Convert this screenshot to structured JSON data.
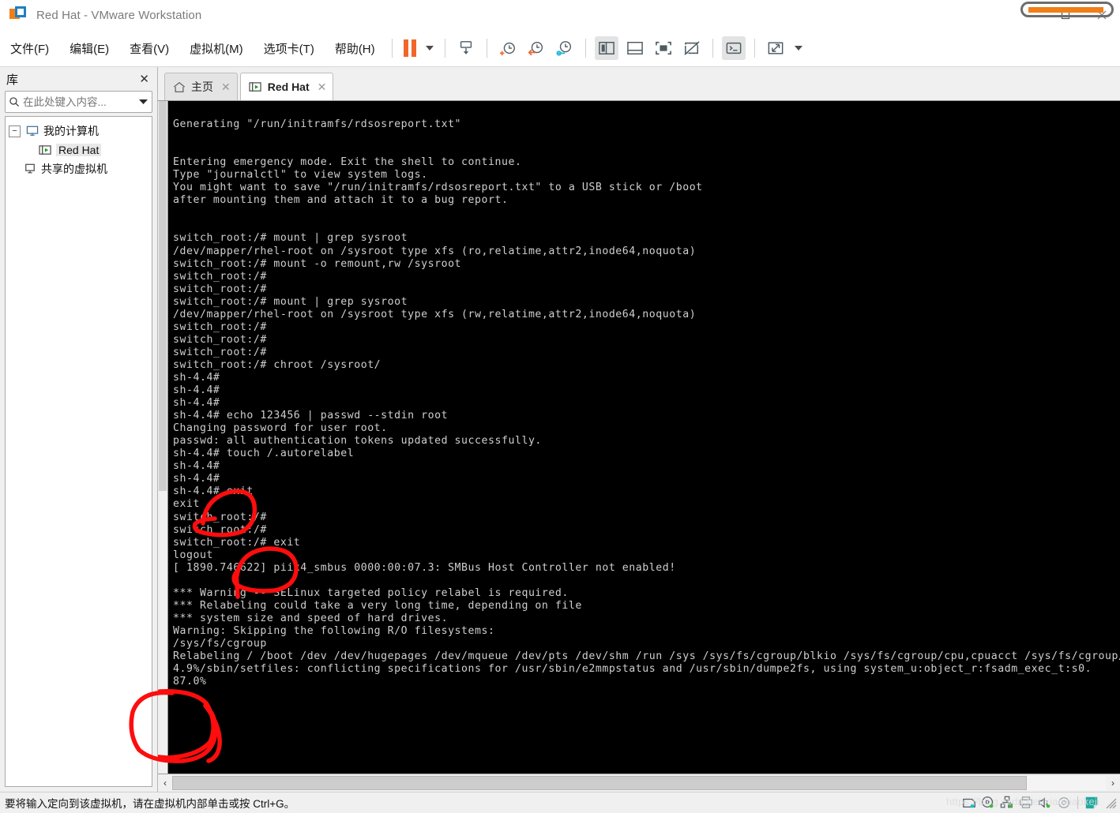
{
  "window": {
    "title": "Red Hat - VMware Workstation",
    "app_icon": "vmware-logo-icon",
    "minimize": "minimize-icon",
    "maximize": "maximize-icon",
    "close": "close-icon"
  },
  "menu": [
    {
      "label": "文件(F)",
      "name": "menu-file"
    },
    {
      "label": "编辑(E)",
      "name": "menu-edit"
    },
    {
      "label": "查看(V)",
      "name": "menu-view"
    },
    {
      "label": "虚拟机(M)",
      "name": "menu-vm"
    },
    {
      "label": "选项卡(T)",
      "name": "menu-tabs"
    },
    {
      "label": "帮助(H)",
      "name": "menu-help"
    }
  ],
  "toolbar": {
    "pause": "pause-icon",
    "pause_dropdown": "chevron-down-icon",
    "items": [
      {
        "name": "send-ctrl-alt-del-icon",
        "title": "发送 Ctrl+Alt+Del"
      },
      {
        "name": "take-snapshot-icon",
        "title": "拍摄此虚拟机的快照"
      },
      {
        "name": "revert-snapshot-icon",
        "title": "恢复至快照"
      },
      {
        "name": "manage-snapshots-icon",
        "title": "管理快照"
      },
      {
        "name": "show-library-icon",
        "title": "显示或隐藏库",
        "selected": true
      },
      {
        "name": "show-thumbnail-bar-icon",
        "title": "显示或隐藏缩略图栏"
      },
      {
        "name": "full-screen-icon",
        "title": "进入全屏模式"
      },
      {
        "name": "unity-mode-icon",
        "title": "进入 Unity 模式"
      },
      {
        "name": "console-view-icon",
        "title": "控制台视图",
        "selected": true
      },
      {
        "name": "stretch-guest-icon",
        "title": "自由拉伸"
      }
    ],
    "stretch_dropdown": "chevron-down-icon"
  },
  "library": {
    "title": "库",
    "close": "close-icon",
    "search": {
      "icon": "search-icon",
      "value": "",
      "placeholder": "在此处键入内容...",
      "dropdown": "chevron-down-icon"
    },
    "tree": [
      {
        "label": "我的计算机",
        "icon": "computer-icon",
        "expander": "−",
        "level": 0,
        "selected": false,
        "name": "tree-item-my-computer"
      },
      {
        "label": "Red Hat",
        "icon": "vm-running-icon",
        "level": 1,
        "selected": true,
        "name": "tree-item-red-hat"
      },
      {
        "label": "共享的虚拟机",
        "icon": "shared-vms-icon",
        "level": 0,
        "selected": false,
        "name": "tree-item-shared-vms"
      }
    ]
  },
  "tabs": [
    {
      "label": "主页",
      "icon": "home-icon",
      "active": false,
      "close": "close-icon",
      "name": "tab-home"
    },
    {
      "label": "Red Hat",
      "icon": "vm-running-icon",
      "active": true,
      "close": "close-icon",
      "name": "tab-red-hat"
    }
  ],
  "terminal": {
    "background": "#000000",
    "foreground": "#cfcfcf",
    "lines": [
      "",
      "Generating \"/run/initramfs/rdsosreport.txt\"",
      "",
      "",
      "Entering emergency mode. Exit the shell to continue.",
      "Type \"journalctl\" to view system logs.",
      "You might want to save \"/run/initramfs/rdsosreport.txt\" to a USB stick or /boot",
      "after mounting them and attach it to a bug report.",
      "",
      "",
      "switch_root:/# mount | grep sysroot",
      "/dev/mapper/rhel-root on /sysroot type xfs (ro,relatime,attr2,inode64,noquota)",
      "switch_root:/# mount -o remount,rw /sysroot",
      "switch_root:/#",
      "switch_root:/#",
      "switch_root:/# mount | grep sysroot",
      "/dev/mapper/rhel-root on /sysroot type xfs (rw,relatime,attr2,inode64,noquota)",
      "switch_root:/#",
      "switch_root:/#",
      "switch_root:/#",
      "switch_root:/# chroot /sysroot/",
      "sh-4.4#",
      "sh-4.4#",
      "sh-4.4#",
      "sh-4.4# echo 123456 | passwd --stdin root",
      "Changing password for user root.",
      "passwd: all authentication tokens updated successfully.",
      "sh-4.4# touch /.autorelabel",
      "sh-4.4#",
      "sh-4.4#",
      "sh-4.4# exit",
      "exit",
      "switch_root:/#",
      "switch_root:/#",
      "switch_root:/# exit",
      "logout",
      "[ 1890.746622] piix4_smbus 0000:00:07.3: SMBus Host Controller not enabled!",
      "",
      "*** Warning -- SELinux targeted policy relabel is required.",
      "*** Relabeling could take a very long time, depending on file",
      "*** system size and speed of hard drives.",
      "Warning: Skipping the following R/O filesystems:",
      "/sys/fs/cgroup",
      "Relabeling / /boot /dev /dev/hugepages /dev/mqueue /dev/pts /dev/shm /run /sys /sys/fs/cgroup/blkio /sys/fs/cgroup/cpu,cpuacct /sys/fs/cgroup/cpuset /sys/fs/cgroup/devices /sys/fs/cgroup/freezer /sys/fs/cgroup/hugetlb /sys/fs/cgroup/memory /sys/fs/cgroup/net_cls,net_prio /sys/fs/cgroup/perf_event /sys/fs/cgroup/pids /sys/fs/cgroup/rdma /sys/fs/cgroup/systemd /sys/fs/pstore /sys/kernel/debug",
      "4.9%/sbin/setfiles: conflicting specifications for /usr/sbin/e2mmpstatus and /usr/sbin/dumpe2fs, using system_u:object_r:fsadm_exec_t:s0.",
      "87.0%"
    ],
    "annotations": [
      {
        "name": "annotation-circle-exit-1",
        "color": "#ff0000",
        "target_text": "sh-4.4# exit"
      },
      {
        "name": "annotation-circle-exit-2",
        "color": "#ff0000",
        "target_text": "switch_root:/# exit"
      },
      {
        "name": "annotation-circle-progress",
        "color": "#ff0000",
        "target_text": "87.0%"
      }
    ],
    "scroll": {
      "vertical": "vertical-scrollbar",
      "horizontal": "horizontal-scrollbar",
      "left_arrow": "‹",
      "right_arrow": "›"
    }
  },
  "statusbar": {
    "message": "要将输入定向到该虚拟机，请在虚拟机内部单击或按 Ctrl+G。",
    "watermark": "https://blog.csdn.net/xiaoxiaokeji",
    "tray": [
      {
        "name": "tray-harddisk-icon"
      },
      {
        "name": "tray-cdrom-icon"
      },
      {
        "name": "tray-network-icon"
      },
      {
        "name": "tray-printer-icon"
      },
      {
        "name": "tray-sound-icon"
      },
      {
        "name": "tray-usb-icon"
      }
    ],
    "tray_extra": {
      "name": "tray-notes-icon"
    },
    "grip": "resize-grip-icon"
  }
}
